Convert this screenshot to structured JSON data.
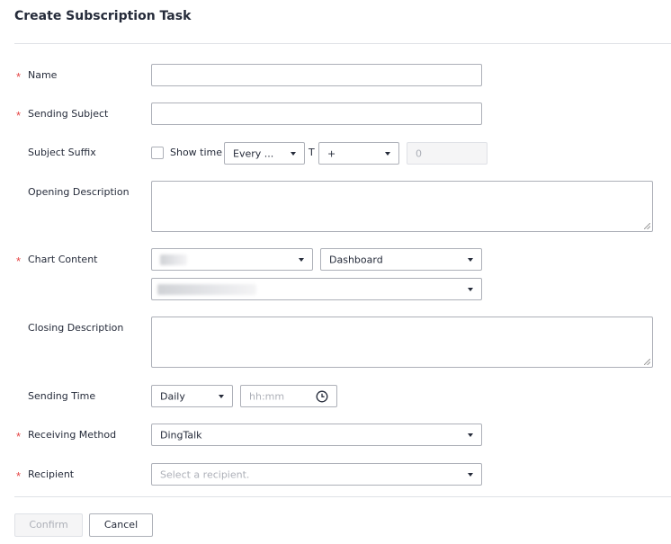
{
  "title": "Create Subscription Task",
  "required_mark": "*",
  "form": {
    "name": {
      "label": "Name",
      "value": ""
    },
    "sending_subject": {
      "label": "Sending Subject",
      "value": ""
    },
    "subject_suffix": {
      "label": "Subject Suffix",
      "show_time_label": "Show time",
      "show_time_checked": false,
      "period": "Every ...",
      "t_label": "T",
      "operator": "+",
      "offset": "0"
    },
    "opening_description": {
      "label": "Opening Description",
      "value": ""
    },
    "chart_content": {
      "label": "Chart Content",
      "type": "Dashboard"
    },
    "closing_description": {
      "label": "Closing Description",
      "value": ""
    },
    "sending_time": {
      "label": "Sending Time",
      "frequency": "Daily",
      "time_placeholder": "hh:mm"
    },
    "receiving_method": {
      "label": "Receiving Method",
      "value": "DingTalk"
    },
    "recipient": {
      "label": "Recipient",
      "placeholder": "Select a recipient."
    }
  },
  "buttons": {
    "confirm": "Confirm",
    "cancel": "Cancel"
  },
  "colors": {
    "required": "#e54545",
    "border": "#adb0b8",
    "divider": "#dfe1e6",
    "text": "#252b3a",
    "placeholder": "#adb0b8"
  },
  "icons": {
    "dropdown": "caret-down-icon",
    "clock": "clock-icon",
    "resize": "resize-handle-icon"
  }
}
